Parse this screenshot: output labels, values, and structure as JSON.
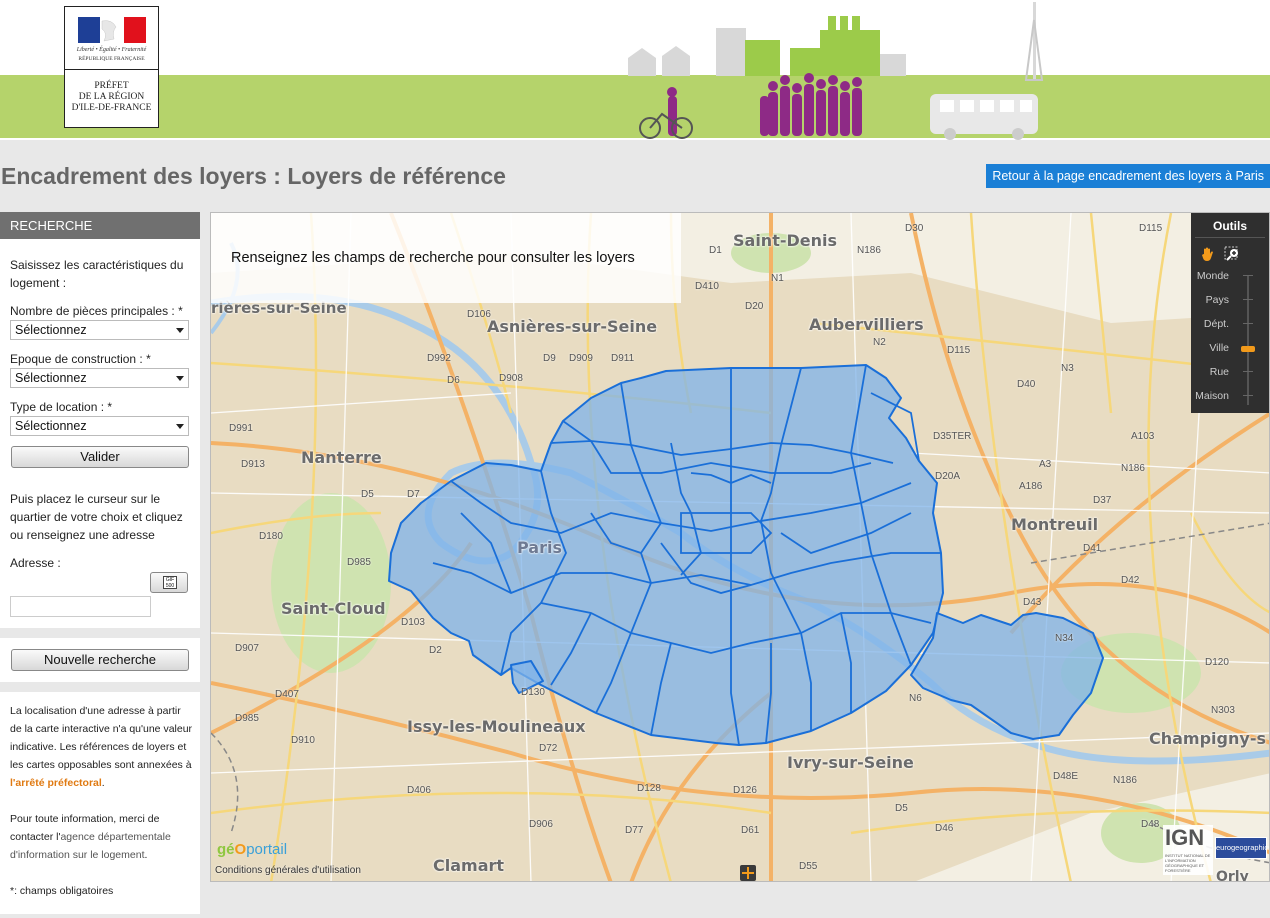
{
  "header": {
    "logo": {
      "motto": "Liberté • Égalité • Fraternité",
      "republic": "RÉPUBLIQUE FRANÇAISE",
      "prefecture": "PRÉFET\nDE LA RÉGION\nD'ILE-DE-FRANCE"
    },
    "banner_color": "#b5d36b"
  },
  "page": {
    "title": "Encadrement des loyers : Loyers de référence",
    "back_link": "Retour à la page encadrement des loyers à Paris"
  },
  "search": {
    "heading": "RECHERCHE",
    "intro": "Saisissez les caractéristiques du logement :",
    "fields": [
      {
        "label": "Nombre de pièces principales : *",
        "value": "Sélectionnez"
      },
      {
        "label": "Epoque de construction : *",
        "value": "Sélectionnez"
      },
      {
        "label": "Type de location : *",
        "value": "Sélectionnez"
      }
    ],
    "validate": "Valider",
    "place_cursor": "Puis placez le curseur sur le quartier de votre choix et cliquez ou renseignez une adresse",
    "address_label": "Adresse :",
    "address_value": "",
    "address_button_icon": "geocode-icon"
  },
  "new_search": "Nouvelle recherche",
  "info": {
    "disclaimer_part1": "La localisation d'une adresse à partir de la carte interactive n'a qu'une valeur indicative. Les références de loyers et les cartes opposables sont annexées à ",
    "disclaimer_link": "l'arrêté préfectoral",
    "disclaimer_end": ".",
    "contact_part1": "Pour toute information, merci de contacter l'",
    "contact_link": "agence départementale d'information sur le logement",
    "contact_end": ".",
    "required_note": "*: champs obligatoires"
  },
  "map": {
    "hint": "Renseignez les champs de recherche pour consulter les loyers",
    "tools": {
      "title": "Outils",
      "zoom_levels": [
        "Monde",
        "Pays",
        "Dépt.",
        "Ville",
        "Rue",
        "Maison"
      ],
      "current_zoom": "Ville"
    },
    "places": [
      "Saint-Denis",
      "Asnières-sur-Seine",
      "Aubervilliers",
      "Nanterre",
      "Paris",
      "Montreuil",
      "Saint-Cloud",
      "Issy-les-Moulineaux",
      "Ivry-sur-Seine",
      "Champigny-s",
      "Clamart",
      "Orly",
      "rières-sur-Seine"
    ],
    "roads": [
      "D30",
      "D115",
      "N186",
      "D1",
      "D410",
      "N1",
      "D20",
      "N2",
      "D115",
      "N3",
      "D40",
      "D35TER",
      "D20A",
      "A186",
      "A103",
      "N186",
      "A3",
      "D37",
      "D41",
      "D42",
      "D43",
      "N34",
      "D120",
      "N303",
      "D48E",
      "N186",
      "D48",
      "D9",
      "D909",
      "D911",
      "D106",
      "D908",
      "D992",
      "D6",
      "D991",
      "D913",
      "D7",
      "D5",
      "D180",
      "D985",
      "D103",
      "D2",
      "D907",
      "D407",
      "D985",
      "D910",
      "D406",
      "D130",
      "D72",
      "D128",
      "D126",
      "D77",
      "D906",
      "D61",
      "D55",
      "D5",
      "N6",
      "D46"
    ],
    "credits": {
      "geoportail_a": "g",
      "geoportail_b": "é",
      "geoportail_c": "O",
      "geoportail_d": "portail",
      "conditions": "Conditions générales d'utilisation",
      "ign": "IGN",
      "ign_sub": "INSTITUT NATIONAL DE L'INFORMATION GÉOGRAPHIQUE ET FORESTIÈRE",
      "eurogeographics": "eurogeographics"
    },
    "colors": {
      "zone_fill": "#7fb3ea",
      "zone_stroke": "#1a6fd8",
      "base": "#f3efe3",
      "urban": "#e8dcc2",
      "green": "#cfe3b0",
      "water": "#a9cbe8",
      "major_road": "#f4b266",
      "road": "#f6d77a"
    }
  }
}
